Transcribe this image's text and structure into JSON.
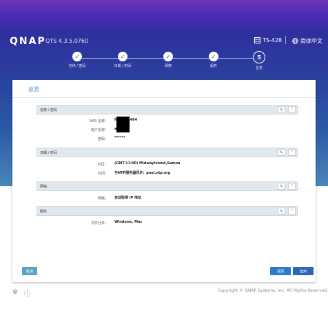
{
  "app": {
    "logo": "QNAP",
    "version": "QTS 4.3.5.0760",
    "model": "TS-428",
    "language": "简体中文"
  },
  "steps": [
    {
      "label": "名称 / 密码",
      "state": "done"
    },
    {
      "label": "日期 / 时间",
      "state": "done"
    },
    {
      "label": "网络",
      "state": "done"
    },
    {
      "label": "服务",
      "state": "done"
    },
    {
      "label": "总览",
      "state": "current",
      "number": "5"
    }
  ],
  "panel": {
    "title": "总览"
  },
  "sections": [
    {
      "title": "名称 / 密码",
      "rows": [
        {
          "key": "NAS 名称：",
          "value": "N   2464"
        },
        {
          "key": "用户名称：",
          "value": "a"
        },
        {
          "key": "密码：",
          "value": "******"
        }
      ]
    },
    {
      "title": "日期 / 时间",
      "rows": [
        {
          "key": "时区：",
          "value": "(GMT-11:00) MidwayIsland,Samoa"
        },
        {
          "key": "时间：",
          "value": "与NTP服务器同步：pool.ntp.org"
        }
      ]
    },
    {
      "title": "网络",
      "rows": [
        {
          "key": "网络：",
          "value": "自动取得 IP 地址"
        }
      ]
    },
    {
      "title": "服务",
      "rows": [
        {
          "key": "文件分享：",
          "value": "Windows, Mac"
        }
      ]
    }
  ],
  "buttons": {
    "cancel": "取消",
    "back": "返回",
    "apply": "套用"
  },
  "footer": {
    "copyright": "Copyright © QNAP Systems, Inc. All Rights Reserved."
  },
  "icons": {
    "edit": "pencil-icon",
    "collapse": "chevron-up-icon",
    "done": "check-icon",
    "model": "server-icon",
    "language": "globe-icon"
  }
}
